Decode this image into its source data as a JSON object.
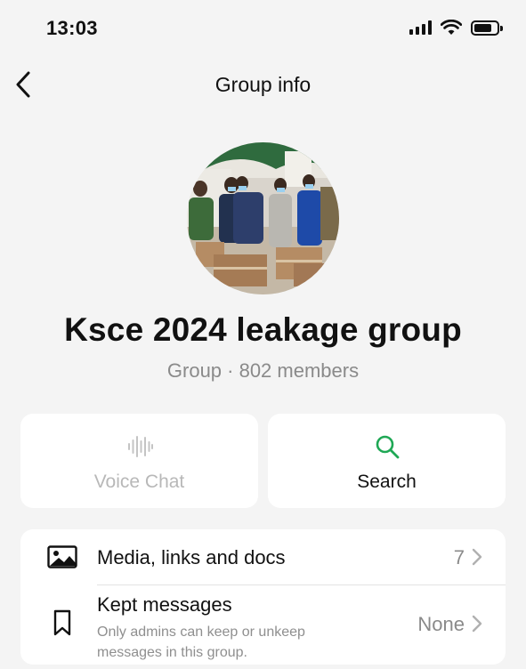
{
  "status_bar": {
    "time": "13:03",
    "signal_icon": "cellular-signal-icon",
    "wifi_icon": "wifi-icon",
    "battery_icon": "battery-icon",
    "battery_level": 0.8
  },
  "nav": {
    "back_icon": "chevron-left-icon",
    "title": "Group info"
  },
  "group": {
    "avatar": "group-photo",
    "name": "Ksce 2024 leakage group",
    "meta": "Group · 802 members"
  },
  "actions": {
    "voice_chat": {
      "label": "Voice Chat",
      "icon": "waveform-icon",
      "enabled": false
    },
    "search": {
      "label": "Search",
      "icon": "search-icon",
      "enabled": true
    }
  },
  "list": {
    "media": {
      "label": "Media, links and docs",
      "value": "7",
      "icon": "image-icon"
    },
    "kept": {
      "label": "Kept messages",
      "subtitle": "Only admins can keep or unkeep messages in this group.",
      "value": "None",
      "icon": "bookmark-icon"
    }
  },
  "colors": {
    "background": "#f4f4f4",
    "card": "#ffffff",
    "accent_green": "#1fa855",
    "disabled_gray": "#b8b8b8",
    "secondary_text": "#8a8a8a"
  }
}
